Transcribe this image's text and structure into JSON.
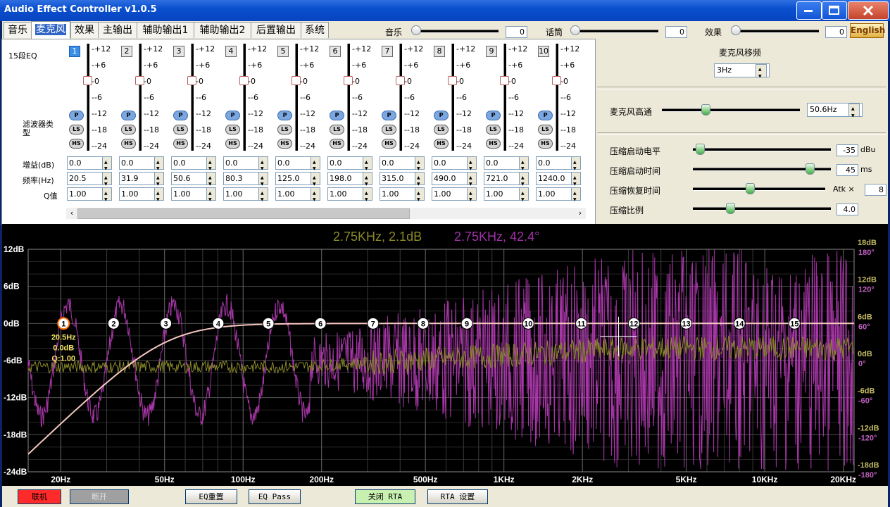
{
  "window": {
    "title": "Audio Effect Controller v1.0.5"
  },
  "tabs": [
    "音乐",
    "麦克风",
    "效果",
    "主输出",
    "辅助输出1",
    "辅助输出2",
    "后置输出",
    "系统"
  ],
  "top_sliders": [
    {
      "label": "音乐",
      "value": "0"
    },
    {
      "label": "话筒",
      "value": "0"
    },
    {
      "label": "效果",
      "value": "0"
    }
  ],
  "english_button": "English",
  "eq": {
    "title": "15段EQ",
    "scale": [
      "+12",
      "+6",
      "0",
      "-6",
      "-12",
      "-18",
      "-24"
    ],
    "bands": [
      "1",
      "2",
      "3",
      "4",
      "5",
      "6",
      "7",
      "8",
      "9",
      "10"
    ],
    "filter_label": "滤波器类型",
    "filters": [
      "P",
      "LS",
      "HS"
    ],
    "gain_label": "增益(dB)",
    "freq_label": "频率(Hz)",
    "q_label": "Q值",
    "gains": [
      "0.0",
      "0.0",
      "0.0",
      "0.0",
      "0.0",
      "0.0",
      "0.0",
      "0.0",
      "0.0",
      "0.0"
    ],
    "freqs": [
      "20.5",
      "31.9",
      "50.6",
      "80.3",
      "125.0",
      "198.0",
      "315.0",
      "490.0",
      "721.0",
      "1240.0"
    ],
    "qs": [
      "1.00",
      "1.00",
      "1.00",
      "1.00",
      "1.00",
      "1.00",
      "1.00",
      "1.00",
      "1.00",
      "1.00"
    ]
  },
  "mic": {
    "shift_label": "麦克风移频",
    "shift_value": "3Hz",
    "highpass_label": "麦克风高通",
    "highpass_value": "50.6Hz",
    "comp": [
      {
        "label": "压缩启动电平",
        "value": "-35",
        "unit": "dBu",
        "level": 0.02
      },
      {
        "label": "压缩启动时间",
        "value": "45",
        "unit": "ms",
        "level": 0.86
      },
      {
        "label": "压缩恢复时间",
        "value": "8",
        "unit": "Atk ×",
        "level": 0.42
      },
      {
        "label": "压缩比例",
        "value": "4.0",
        "unit": "",
        "level": 0.25
      }
    ],
    "highpass_level": 0.3
  },
  "graph": {
    "readout_gain": "2.75KHz, 2.1dB",
    "readout_phase": "2.75KHz, 42.4°",
    "y_left": [
      "12dB",
      "6dB",
      "0dB",
      "-6dB",
      "-12dB",
      "-18dB",
      "-24dB"
    ],
    "y_right_db": [
      "18dB",
      "12dB",
      "6dB",
      "0dB",
      "-6dB",
      "-12dB",
      "-18dB"
    ],
    "y_right_deg": [
      "180°",
      "120°",
      "60°",
      "0°",
      "-60°",
      "-120°",
      "-180°"
    ],
    "x_labels": [
      "20Hz",
      "50Hz",
      "100Hz",
      "200Hz",
      "500Hz",
      "1KHz",
      "2KHz",
      "5KHz",
      "10KHz",
      "20KHz"
    ],
    "nodes": [
      "1",
      "2",
      "3",
      "4",
      "5",
      "6",
      "7",
      "8",
      "9",
      "10",
      "11",
      "12",
      "13",
      "14",
      "15"
    ],
    "node_info": [
      "20.5Hz",
      "0.0dB",
      "Q:1.00"
    ],
    "colors": {
      "gain": "#8a8a2a",
      "phase": "#b83cb8",
      "curve": "#f5c8c0"
    }
  },
  "bottom": [
    "联机",
    "断开",
    "EQ重置",
    "EQ Pass",
    "关闭 RTA",
    "RTA 设置"
  ]
}
